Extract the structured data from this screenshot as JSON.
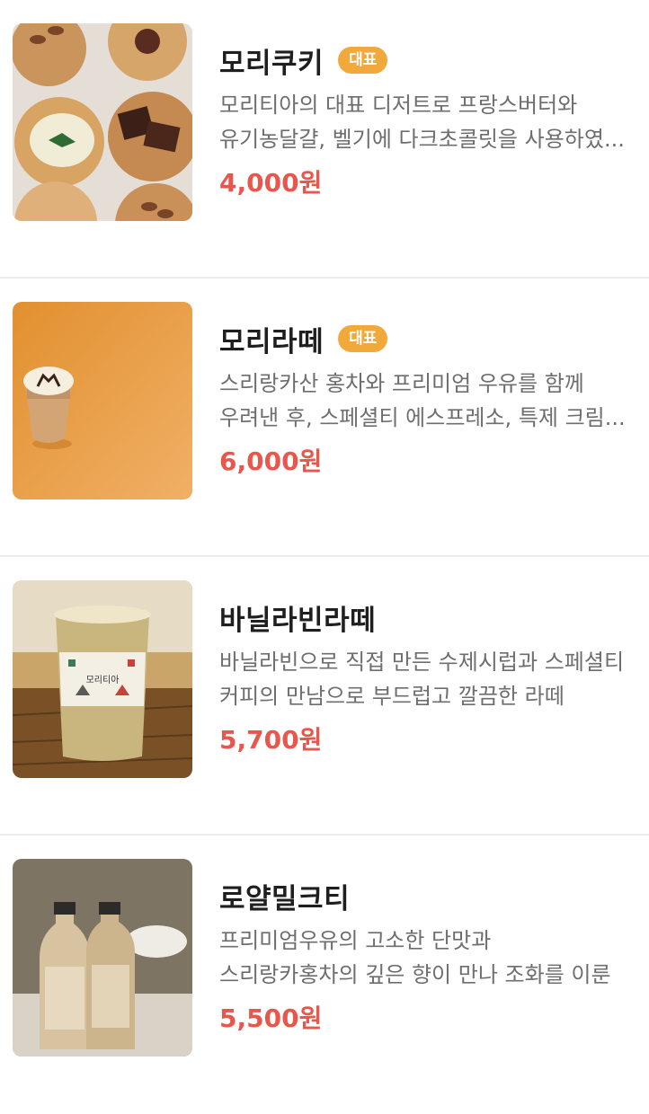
{
  "menu": {
    "items": [
      {
        "name": "모리쿠키",
        "badge": "대표",
        "description": "모리티아의 대표 디저트로 프랑스버터와 유기농달걀, 벨기에 다크초콜릿을 사용하였...",
        "price": "4,000원",
        "image": "cookies-photo"
      },
      {
        "name": "모리라떼",
        "badge": "대표",
        "description": "스리랑카산 홍차와 프리미엄 우유를 함께 우려낸 후, 스페셜티 에스프레소, 특제 크림...",
        "price": "6,000원",
        "image": "latte-orange-photo"
      },
      {
        "name": "바닐라빈라떼",
        "description": "바닐라빈으로 직접 만든 수제시럽과 스페셜티 커피의 만남으로 부드럽고 깔끔한 라떼",
        "price": "5,700원",
        "image": "vanilla-latte-cup-photo",
        "cup_label": "모리티아"
      },
      {
        "name": "로얄밀크티",
        "description": "프리미엄우유의 고소한 단맛과 스리랑카홍차의 깊은 향이 만나 조화를 이룬 모리티아만...",
        "price": "5,500원",
        "image": "milk-tea-bottles-photo"
      }
    ]
  },
  "colors": {
    "price": "#e8574c",
    "badge": "#f2a93b",
    "divider": "#ececec"
  }
}
